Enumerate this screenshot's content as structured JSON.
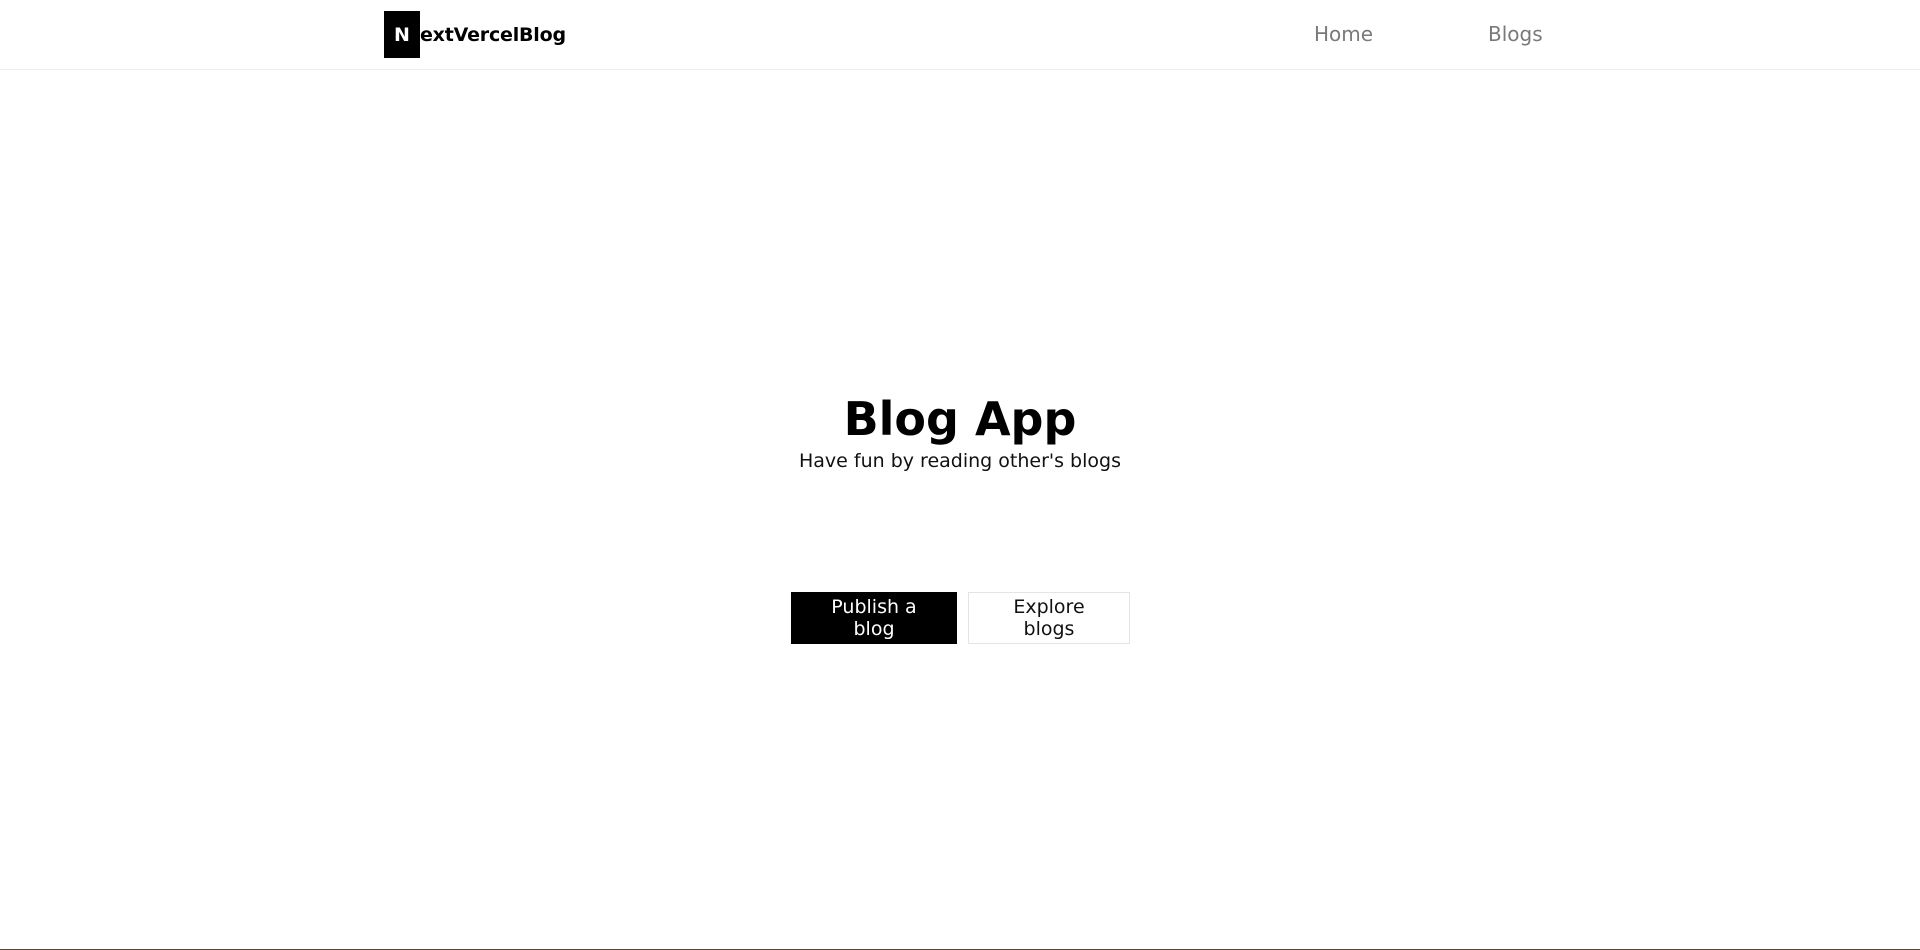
{
  "header": {
    "brand_mark": "N",
    "brand_rest": "extVercelBlog",
    "nav": [
      {
        "label": "Home"
      },
      {
        "label": "Blogs"
      }
    ]
  },
  "hero": {
    "title": "Blog App",
    "subtitle": "Have fun by reading other's blogs"
  },
  "actions": {
    "primary_label": "Publish a blog",
    "secondary_label": "Explore blogs"
  },
  "colors": {
    "brand_bg": "#000000",
    "brand_text": "#ffffff",
    "nav_text": "#7a7a7a",
    "primary_button_bg": "#000000"
  }
}
